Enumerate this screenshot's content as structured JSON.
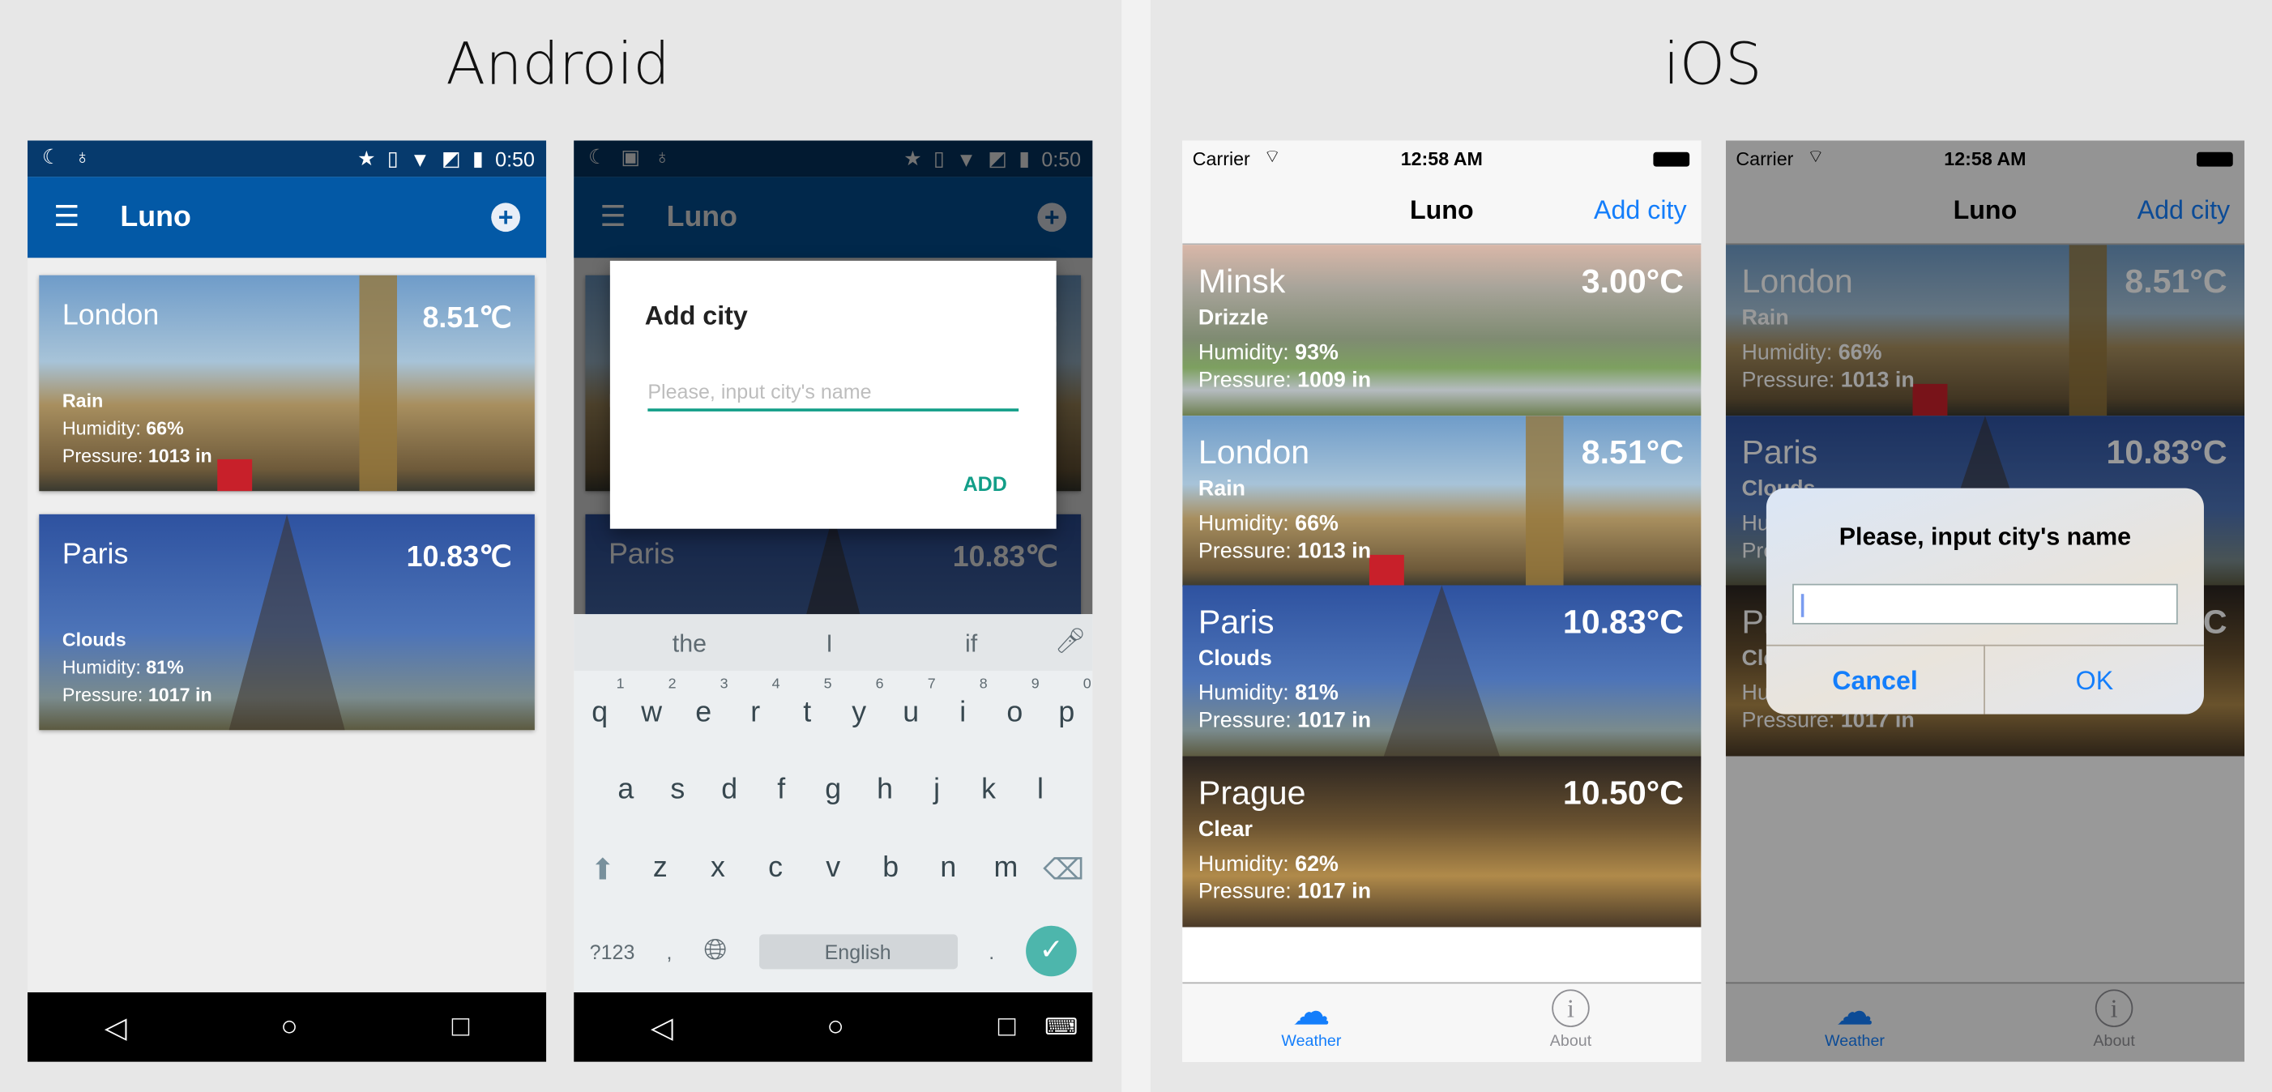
{
  "labels": {
    "android": "Android",
    "ios": "iOS"
  },
  "android": {
    "status": {
      "time": "0:50",
      "icons": [
        "moon-icon",
        "android-debug-icon",
        "star-icon",
        "vibrate-icon",
        "wifi-icon",
        "no-sim-icon",
        "battery-charging-icon"
      ]
    },
    "app_title": "Luno",
    "menu_icon": "☰",
    "add_icon": "+",
    "cities": [
      {
        "city": "London",
        "temp": "8.51℃",
        "condition": "Rain",
        "humidity_label": "Humidity: ",
        "humidity": "66%",
        "pressure_label": "Pressure: ",
        "pressure": "1013 in",
        "bg": "london"
      },
      {
        "city": "Paris",
        "temp": "10.83℃",
        "condition": "Clouds",
        "humidity_label": "Humidity: ",
        "humidity": "81%",
        "pressure_label": "Pressure: ",
        "pressure": "1017 in",
        "bg": "paris"
      }
    ],
    "dialog": {
      "title": "Add city",
      "placeholder": "Please, input city's name",
      "add": "ADD",
      "accent": "#129e88"
    },
    "keyboard": {
      "suggestions": [
        "the",
        "I",
        "if"
      ],
      "row1": [
        "q",
        "w",
        "e",
        "r",
        "t",
        "y",
        "u",
        "i",
        "o",
        "p"
      ],
      "digits": [
        "1",
        "2",
        "3",
        "4",
        "5",
        "6",
        "7",
        "8",
        "9",
        "0"
      ],
      "row2": [
        "a",
        "s",
        "d",
        "f",
        "g",
        "h",
        "j",
        "k",
        "l"
      ],
      "row3": [
        "z",
        "x",
        "c",
        "v",
        "b",
        "n",
        "m"
      ],
      "symbols": "?123",
      "comma": ",",
      "space": "English",
      "period": "."
    },
    "colors": {
      "primary": "#0359a6",
      "status": "#063a6d"
    }
  },
  "ios": {
    "status": {
      "carrier": "Carrier",
      "time": "12:58 AM"
    },
    "title": "Luno",
    "add_city": "Add city",
    "cities": [
      {
        "city": "Minsk",
        "temp": "3.00°C",
        "condition": "Drizzle",
        "humidity_label": "Humidity: ",
        "humidity": "93%",
        "pressure_label": "Pressure: ",
        "pressure": "1009 in",
        "bg": "minsk"
      },
      {
        "city": "London",
        "temp": "8.51°C",
        "condition": "Rain",
        "humidity_label": "Humidity: ",
        "humidity": "66%",
        "pressure_label": "Pressure: ",
        "pressure": "1013 in",
        "bg": "london"
      },
      {
        "city": "Paris",
        "temp": "10.83°C",
        "condition": "Clouds",
        "humidity_label": "Humidity: ",
        "humidity": "81%",
        "pressure_label": "Pressure: ",
        "pressure": "1017 in",
        "bg": "paris"
      },
      {
        "city": "Prague",
        "temp": "10.50°C",
        "condition": "Clear",
        "humidity_label": "Humidity: ",
        "humidity": "62%",
        "pressure_label": "Pressure: ",
        "pressure": "1017 in",
        "bg": "prague"
      }
    ],
    "tabs": [
      {
        "label": "Weather",
        "icon": "cloud-icon",
        "active": true
      },
      {
        "label": "About",
        "icon": "info-icon",
        "active": false
      }
    ],
    "alert": {
      "title": "Please, input city's name",
      "cancel": "Cancel",
      "ok": "OK"
    },
    "colors": {
      "tint": "#147efb"
    }
  }
}
